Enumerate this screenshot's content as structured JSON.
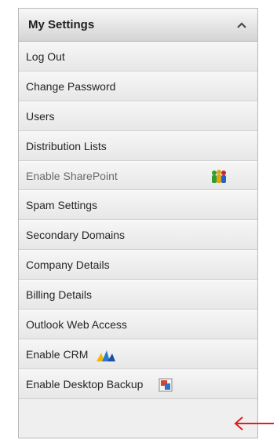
{
  "panel": {
    "title": "My Settings",
    "collapse_icon": "chevron-up-icon",
    "items": [
      {
        "label": "Log Out",
        "id": "log-out"
      },
      {
        "label": "Change Password",
        "id": "change-password"
      },
      {
        "label": "Users",
        "id": "users"
      },
      {
        "label": "Distribution Lists",
        "id": "distribution-lists"
      },
      {
        "label": "Enable SharePoint",
        "id": "enable-sharepoint",
        "icon": "sharepoint-people-icon"
      },
      {
        "label": "Spam Settings",
        "id": "spam-settings"
      },
      {
        "label": "Secondary Domains",
        "id": "secondary-domains"
      },
      {
        "label": "Company Details",
        "id": "company-details"
      },
      {
        "label": "Billing Details",
        "id": "billing-details"
      },
      {
        "label": "Outlook Web Access",
        "id": "outlook-web-access"
      },
      {
        "label": "Enable CRM",
        "id": "enable-crm",
        "icon": "crm-icon"
      },
      {
        "label": "Enable Desktop Backup",
        "id": "enable-desktop-backup",
        "icon": "desktop-backup-icon"
      }
    ]
  },
  "annotation": {
    "icon": "red-arrow-left-icon",
    "color": "#e02020"
  }
}
